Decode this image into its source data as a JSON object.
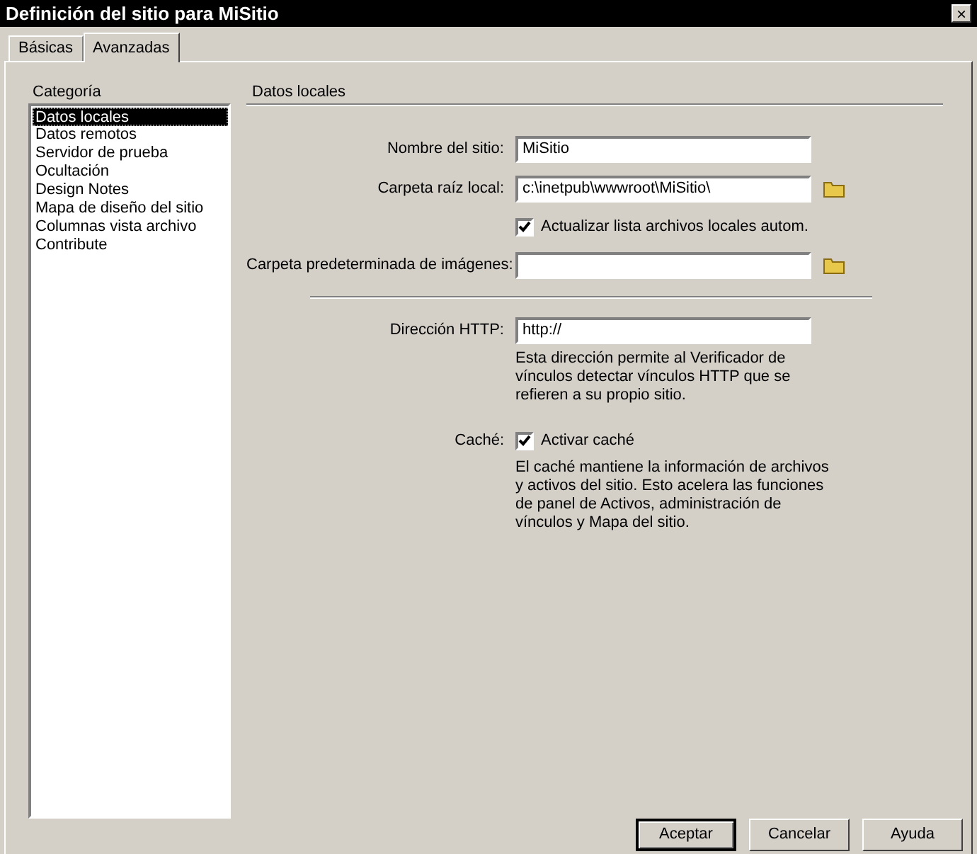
{
  "window": {
    "title": "Definición del sitio para MiSitio",
    "close": "×"
  },
  "tabs": [
    {
      "label": "Básicas",
      "selected": false
    },
    {
      "label": "Avanzadas",
      "selected": true
    }
  ],
  "category": {
    "label": "Categoría",
    "items": [
      {
        "label": "Datos locales",
        "selected": true
      },
      {
        "label": "Datos remotos",
        "selected": false
      },
      {
        "label": "Servidor de prueba",
        "selected": false
      },
      {
        "label": "Ocultación",
        "selected": false
      },
      {
        "label": "Design Notes",
        "selected": false
      },
      {
        "label": "Mapa de diseño del sitio",
        "selected": false
      },
      {
        "label": "Columnas vista archivo",
        "selected": false
      },
      {
        "label": "Contribute",
        "selected": false
      }
    ]
  },
  "section": {
    "title": "Datos locales"
  },
  "fields": [
    {
      "kind": "text",
      "label": "Nombre del sitio:",
      "value": "MiSitio",
      "browse": false
    },
    {
      "kind": "text",
      "label": "Carpeta raíz local:",
      "value": "c:\\inetpub\\wwwroot\\MiSitio\\",
      "browse": true
    },
    {
      "kind": "check",
      "text": "Actualizar lista archivos locales autom.",
      "checked": true
    },
    {
      "kind": "text",
      "label": "Carpeta predeterminada de imágenes:",
      "browse": true
    },
    {
      "kind": "separator"
    },
    {
      "kind": "text",
      "label": "Dirección HTTP:",
      "value": "http://",
      "browse": false
    },
    {
      "kind": "note",
      "text": "Esta dirección permite al Verificador de vínculos detectar vínculos HTTP que se refieren a su propio sitio."
    },
    {
      "kind": "check",
      "label": "Caché:",
      "text": "Activar caché",
      "checked": true
    },
    {
      "kind": "note",
      "text": "El caché mantiene la información de archivos y activos del sitio. Esto acelera las funciones de panel de Activos, administración de vínculos y Mapa del sitio."
    }
  ],
  "buttons": [
    {
      "label": "Aceptar",
      "default": true
    },
    {
      "label": "Cancelar",
      "default": false
    },
    {
      "label": "Ayuda",
      "default": false
    }
  ]
}
